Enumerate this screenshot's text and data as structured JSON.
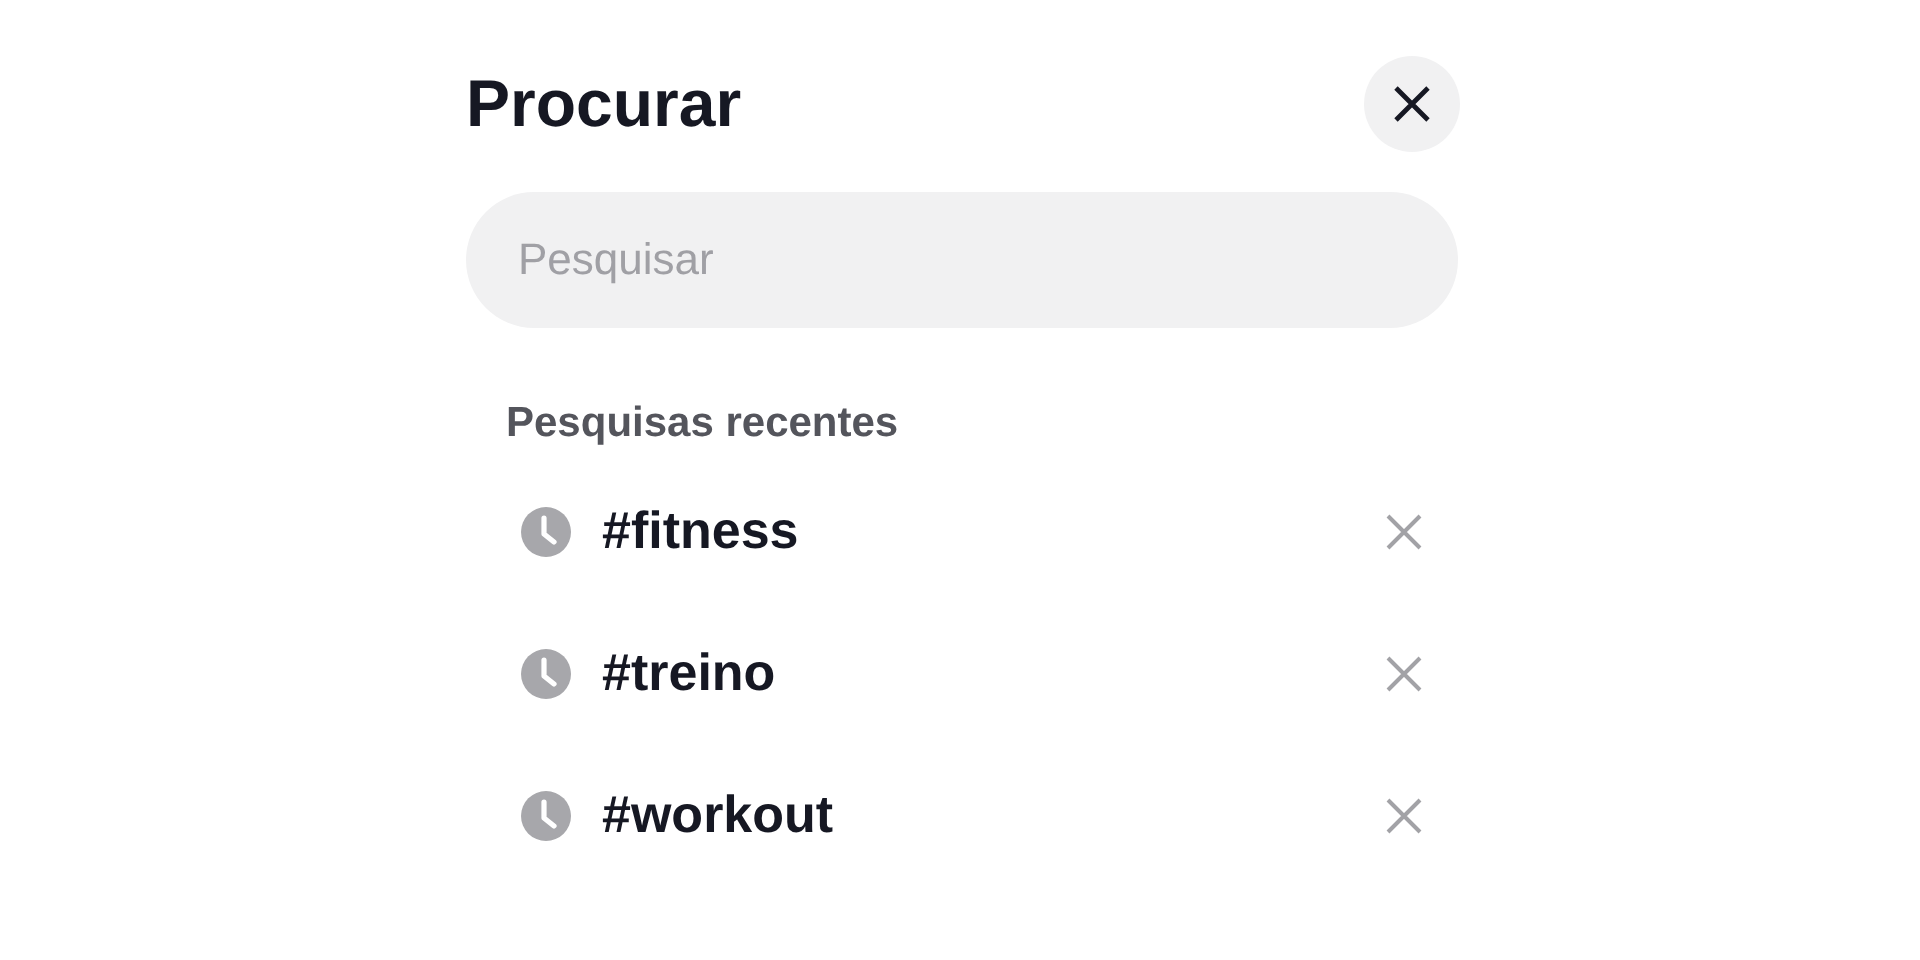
{
  "header": {
    "title": "Procurar"
  },
  "search": {
    "placeholder": "Pesquisar"
  },
  "recent": {
    "heading": "Pesquisas recentes",
    "items": [
      {
        "label": "#fitness"
      },
      {
        "label": "#treino"
      },
      {
        "label": "#workout"
      }
    ]
  }
}
